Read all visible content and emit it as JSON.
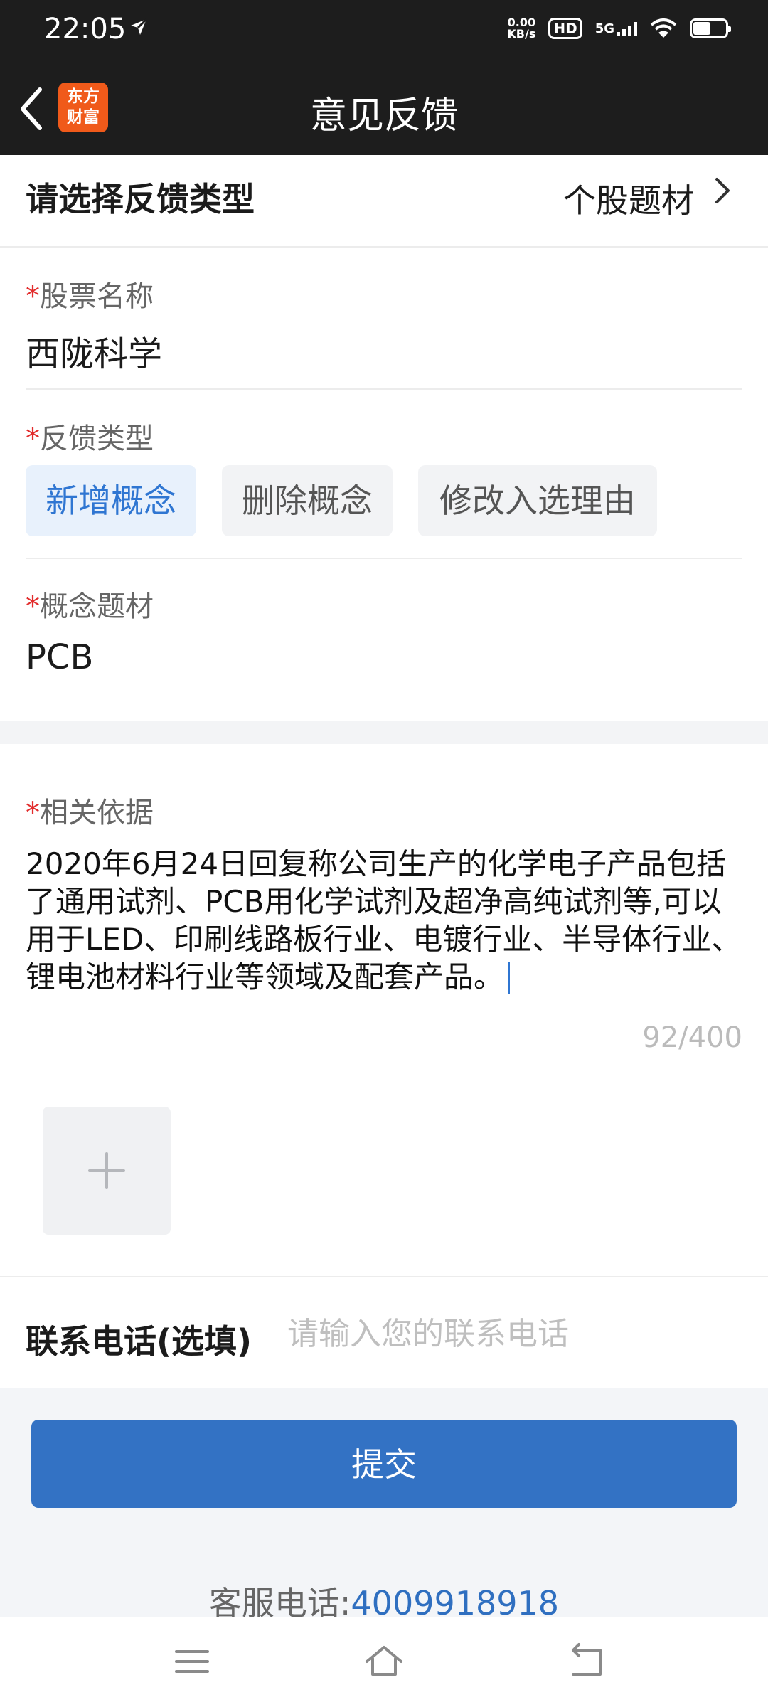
{
  "status_bar": {
    "time": "22:05",
    "net_speed_value": "0.00",
    "net_speed_unit": "KB/s",
    "hd_badge": "HD",
    "network": "5G",
    "battery_level": 0.55
  },
  "header": {
    "title": "意见反馈",
    "logo_line1": "东方",
    "logo_line2": "财富",
    "back_icon": "chevron-left-icon"
  },
  "feedback_type_row": {
    "label": "请选择反馈类型",
    "value": "个股题材",
    "icon": "chevron-right-icon"
  },
  "stock_name": {
    "required_mark": "*",
    "label": "股票名称",
    "value": "西陇科学"
  },
  "feedback_kind": {
    "required_mark": "*",
    "label": "反馈类型",
    "options": [
      "新增概念",
      "删除概念",
      "修改入选理由"
    ],
    "selected_index": 0
  },
  "concept": {
    "required_mark": "*",
    "label": "概念题材",
    "value": "PCB"
  },
  "basis": {
    "required_mark": "*",
    "label": "相关依据",
    "text": "2020年6月24日回复称公司生产的化学电子产品包括了通用试剂、PCB用化学试剂及超净高纯试剂等,可以用于LED、印刷线路板行业、电镀行业、半导体行业、锂电池材料行业等领域及配套产品。",
    "counter": "92/400",
    "add_icon": "plus-icon"
  },
  "contact": {
    "label": "联系电话(选填)",
    "placeholder": "请输入您的联系电话",
    "value": ""
  },
  "submit_label": "提交",
  "service": {
    "label": "客服电话:",
    "phone": "4009918918"
  },
  "nav_bar": {
    "icons": [
      "menu-icon",
      "home-icon",
      "back-icon"
    ]
  },
  "colors": {
    "header_bg": "#1d1d1d",
    "accent": "#3372c4",
    "required": "#e22c2c",
    "chip_active_bg": "#e8f1fc",
    "chip_active_text": "#2f76d2"
  }
}
